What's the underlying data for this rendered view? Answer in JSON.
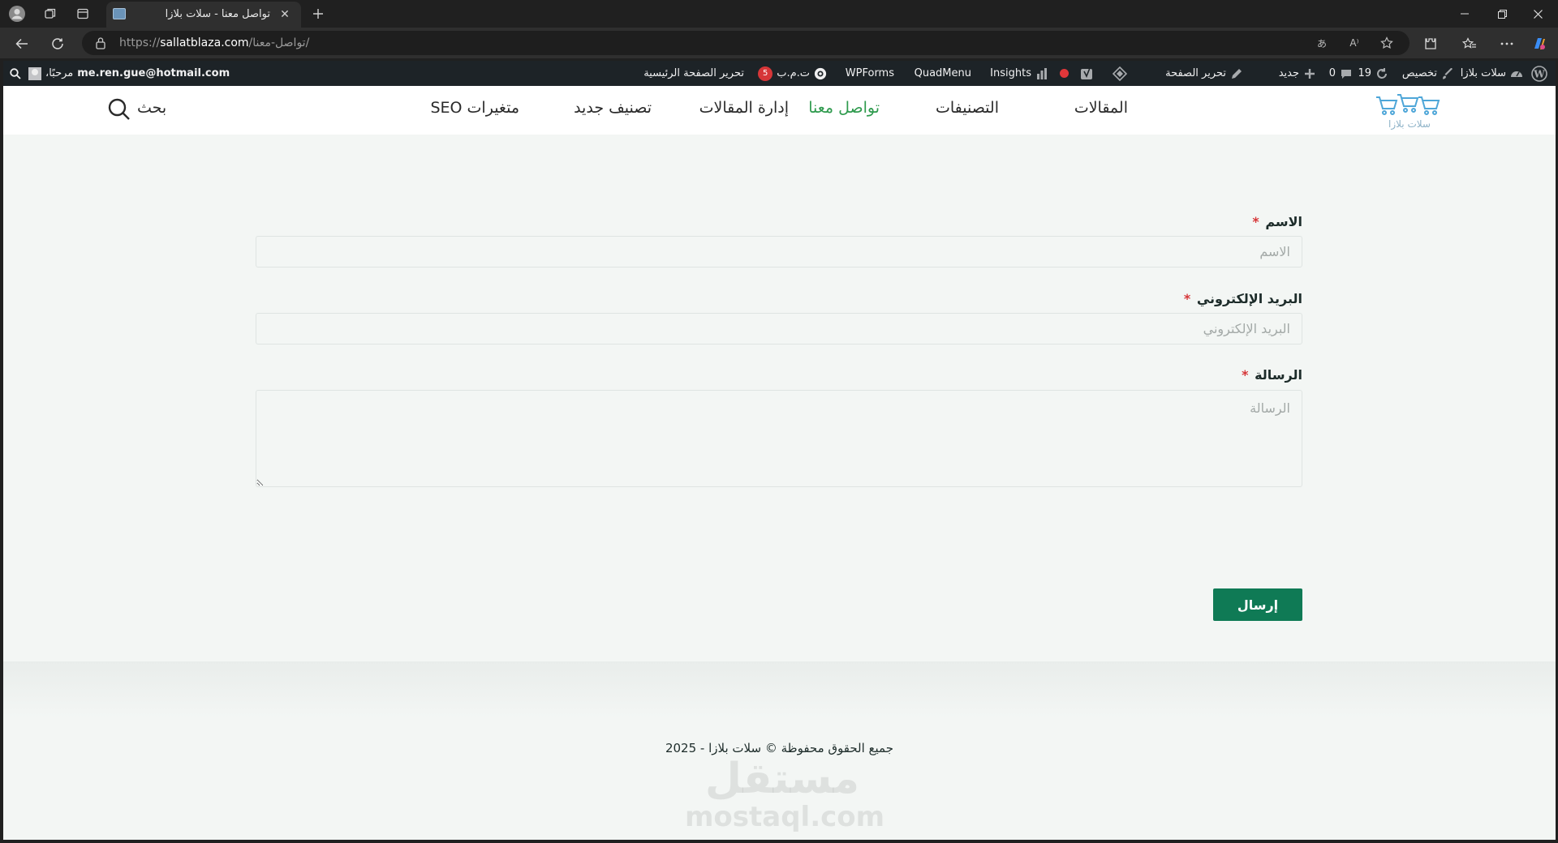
{
  "browser": {
    "tab_title": "تواصل معنا - سلات بلازا",
    "url_prefix": "https://",
    "url_host": "sallatblaza.com",
    "url_path": "/تواصل-معنا/"
  },
  "adminbar": {
    "site_name": "سلات بلازا",
    "customize": "تخصيص",
    "updates_count": "19",
    "comments_count": "0",
    "new": "جديد",
    "edit_page": "تحرير الصفحة",
    "insights": "Insights",
    "quadmenu": "QuadMenu",
    "wpforms": "WPForms",
    "seo_label": "ت.م.ب",
    "seo_count": "5",
    "edit_home": "تحرير الصفحة الرئيسية",
    "greeting": "مرحبًا،",
    "user_email": "me.ren.gue@hotmail.com"
  },
  "header": {
    "logo_text": "سلات بلازا",
    "menu": [
      {
        "label": "المقالات",
        "active": false
      },
      {
        "label": "التصنيفات",
        "active": false
      },
      {
        "label": "تواصل معنا",
        "active": true
      },
      {
        "label": "إدارة المقالات",
        "active": false
      },
      {
        "label": "تصنيف جديد",
        "active": false
      },
      {
        "label": "متغيرات SEO",
        "active": false
      }
    ],
    "search_label": "بحث"
  },
  "form": {
    "name_label": "الاسم",
    "name_placeholder": "الاسم",
    "email_label": "البريد الإلكتروني",
    "email_placeholder": "البريد الإلكتروني",
    "message_label": "الرسالة",
    "message_placeholder": "الرسالة",
    "required_mark": "*",
    "submit_label": "إرسال"
  },
  "footer": {
    "copyright": "جميع الحقوق محفوظة © سلات بلازا - 2025"
  },
  "watermark": {
    "arabic": "مستقل",
    "latin": "mostaql.com"
  },
  "colors": {
    "accent_green": "#2e9a4d",
    "button_green": "#0f7a55",
    "required_red": "#d63638",
    "adminbar_bg": "#1d2327",
    "page_bg": "#f3f6f4"
  }
}
